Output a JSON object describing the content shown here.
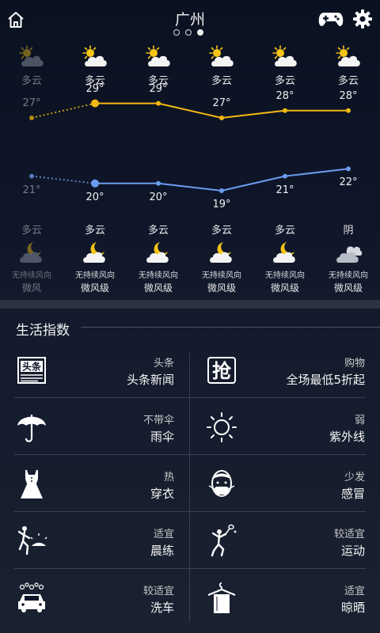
{
  "header": {
    "city": "广州",
    "pages": 3,
    "active_page": 3,
    "home_icon": "home-icon",
    "game_icon": "gamepad-icon",
    "settings_icon": "gear-icon"
  },
  "forecast": {
    "days": [
      {
        "day_condition": "多云",
        "day_icon": "partly-cloudy-day-icon",
        "high": "27°",
        "low": "21°",
        "night_condition": "多云",
        "night_icon": "partly-cloudy-night-icon",
        "wind_direction": "无持续风向",
        "wind_level": "微风",
        "past": true
      },
      {
        "day_condition": "多云",
        "day_icon": "partly-cloudy-day-icon",
        "high": "29°",
        "low": "20°",
        "night_condition": "多云",
        "night_icon": "partly-cloudy-night-icon",
        "wind_direction": "无持续风向",
        "wind_level": "微风级",
        "past": false
      },
      {
        "day_condition": "多云",
        "day_icon": "partly-cloudy-day-icon",
        "high": "29°",
        "low": "20°",
        "night_condition": "多云",
        "night_icon": "partly-cloudy-night-icon",
        "wind_direction": "无持续风向",
        "wind_level": "微风级",
        "past": false
      },
      {
        "day_condition": "多云",
        "day_icon": "partly-cloudy-day-icon",
        "high": "27°",
        "low": "19°",
        "night_condition": "多云",
        "night_icon": "partly-cloudy-night-icon",
        "wind_direction": "无持续风向",
        "wind_level": "微风级",
        "past": false
      },
      {
        "day_condition": "多云",
        "day_icon": "partly-cloudy-day-icon",
        "high": "28°",
        "low": "21°",
        "night_condition": "多云",
        "night_icon": "partly-cloudy-night-icon",
        "wind_direction": "无持续风向",
        "wind_level": "微风级",
        "past": false
      },
      {
        "day_condition": "多云",
        "day_icon": "partly-cloudy-day-icon",
        "high": "28°",
        "low": "22°",
        "night_condition": "阴",
        "night_icon": "overcast-icon",
        "wind_direction": "无持续风向",
        "wind_level": "微风级",
        "past": false
      }
    ],
    "high_color": "#f5b913",
    "low_color": "#6b9bef"
  },
  "life_index": {
    "title": "生活指数",
    "items": [
      {
        "icon": "headline-news-icon",
        "sub": "头条",
        "main": "头条新闻"
      },
      {
        "icon": "shopping-grab-icon",
        "sub": "购物",
        "main": "全场最低5折起"
      },
      {
        "icon": "umbrella-icon",
        "sub": "不带伞",
        "main": "雨伞"
      },
      {
        "icon": "sun-uv-icon",
        "sub": "弱",
        "main": "紫外线"
      },
      {
        "icon": "dress-icon",
        "sub": "热",
        "main": "穿衣"
      },
      {
        "icon": "mask-cold-icon",
        "sub": "少发",
        "main": "感冒"
      },
      {
        "icon": "morning-exercise-icon",
        "sub": "适宜",
        "main": "晨练"
      },
      {
        "icon": "sport-badminton-icon",
        "sub": "较适宜",
        "main": "运动"
      },
      {
        "icon": "car-wash-icon",
        "sub": "较适宜",
        "main": "洗车"
      },
      {
        "icon": "clothes-drying-icon",
        "sub": "适宜",
        "main": "晾晒"
      }
    ]
  }
}
